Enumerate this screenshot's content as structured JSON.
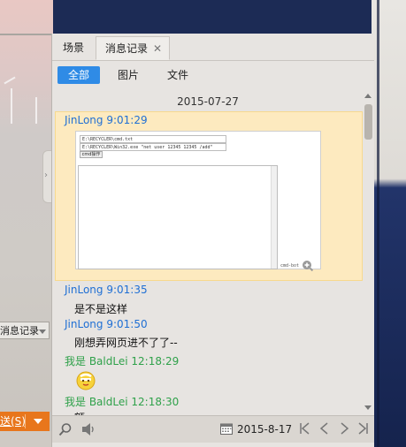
{
  "background_left": {
    "dropdown_label": "消息记录",
    "send_label": "送(S)"
  },
  "tabs": [
    {
      "label": "场景"
    },
    {
      "label": "消息记录",
      "close": "✕"
    }
  ],
  "filters": [
    {
      "label": "全部",
      "active": true
    },
    {
      "label": "图片"
    },
    {
      "label": "文件"
    }
  ],
  "date_separator": "2015-07-27",
  "messages": [
    {
      "sender": "JinLong",
      "time": "9:01:29",
      "type": "image",
      "image": {
        "field1": "E:\\RECYCLER\\cmd.txt",
        "field2": "E:\\RECYCLER\\Win32.exe \"net user 12345 12345 /add\"",
        "button": "cmd操作",
        "caption": "cmd-bot"
      }
    },
    {
      "sender": "JinLong",
      "time": "9:01:35",
      "text": "是不是这样"
    },
    {
      "sender": "JinLong",
      "time": "9:01:50",
      "text": "刚想弄网页进不了了--"
    },
    {
      "sender": "我是 BaldLei",
      "time": "12:18:29",
      "type": "emoji"
    },
    {
      "sender": "我是 BaldLei",
      "time": "12:18:30",
      "text": "额"
    }
  ],
  "toolbar": {
    "date": "2015-8-17"
  },
  "colors": {
    "accent": "#2f8be6",
    "them_sender": "#1f6fd4",
    "me_sender": "#2fa14a",
    "highlight": "#fdeabf"
  }
}
